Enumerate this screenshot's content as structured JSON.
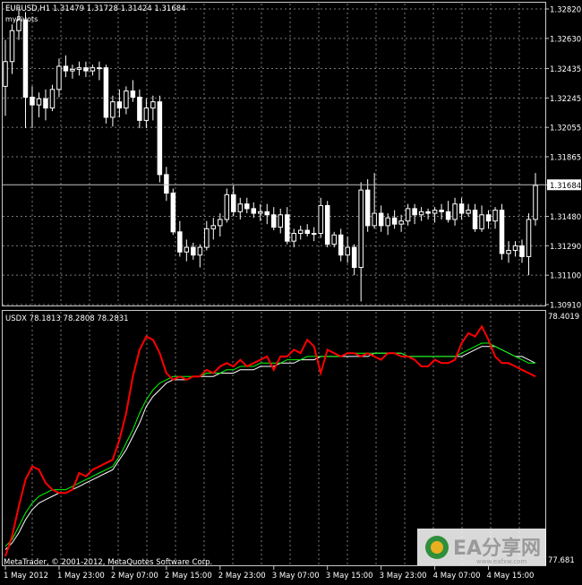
{
  "colors": {
    "background": "#000000",
    "grid": "#7a7a7a",
    "frame": "#c8c8c8",
    "candle": "#ffffff",
    "usdx_line": "#ff0000",
    "ma_fast": "#00ff00",
    "ma_slow": "#ffffff",
    "current_price_line": "#c0c0c0"
  },
  "header": {
    "symbol_line": "EURUSD,H1  1.31479 1.31728 1.31424 1.31684",
    "indicator_label": "myPivots"
  },
  "sub_header": {
    "label": "USDX 78.1813 78.2808 78.2831"
  },
  "footer": {
    "copyright": "MetaTrader, © 2001-2012, MetaQuotes Software Corp.",
    "watermark": "EA分享网",
    "watermark_url": "www.eafxw.com"
  },
  "chart_data": [
    {
      "type": "candlestick",
      "symbol": "EURUSD",
      "timeframe": "H1",
      "ylim": [
        1.3091,
        1.3282
      ],
      "y_ticks": [
        "1.32820",
        "1.32630",
        "1.32435",
        "1.32245",
        "1.32055",
        "1.31865",
        "1.31684",
        "1.31480",
        "1.31290",
        "1.31100",
        "1.30910"
      ],
      "y_tick_values": [
        1.3282,
        1.3263,
        1.32435,
        1.32245,
        1.32055,
        1.31865,
        1.31684,
        1.3148,
        1.3129,
        1.311,
        1.3091
      ],
      "current_price": 1.31684,
      "x_ticks": [
        "1 May 2012",
        "1 May 23:00",
        "2 May 07:00",
        "2 May 15:00",
        "2 May 23:00",
        "3 May 07:00",
        "3 May 15:00",
        "3 May 23:00",
        "4 May 07:00",
        "4 May 15:00"
      ],
      "x_tick_index": [
        0,
        8,
        16,
        24,
        32,
        40,
        48,
        56,
        64,
        72
      ],
      "candles": [
        [
          1.3232,
          1.3262,
          1.3213,
          1.3248
        ],
        [
          1.3248,
          1.3272,
          1.324,
          1.3268
        ],
        [
          1.3268,
          1.3282,
          1.3262,
          1.3275
        ],
        [
          1.3275,
          1.328,
          1.3205,
          1.3225
        ],
        [
          1.3225,
          1.3232,
          1.3205,
          1.322
        ],
        [
          1.322,
          1.3228,
          1.3212,
          1.3224
        ],
        [
          1.3224,
          1.323,
          1.321,
          1.3218
        ],
        [
          1.3218,
          1.3233,
          1.3216,
          1.323
        ],
        [
          1.323,
          1.325,
          1.3225,
          1.3245
        ],
        [
          1.3245,
          1.3252,
          1.3238,
          1.3242
        ],
        [
          1.3242,
          1.3246,
          1.3237,
          1.3243
        ],
        [
          1.3243,
          1.3248,
          1.3239,
          1.3244
        ],
        [
          1.3244,
          1.3248,
          1.3238,
          1.3242
        ],
        [
          1.3242,
          1.3246,
          1.3239,
          1.3244
        ],
        [
          1.3244,
          1.3248,
          1.3236,
          1.3244
        ],
        [
          1.3244,
          1.3246,
          1.3208,
          1.3212
        ],
        [
          1.3212,
          1.3226,
          1.3206,
          1.3222
        ],
        [
          1.3222,
          1.323,
          1.3212,
          1.3218
        ],
        [
          1.3218,
          1.3232,
          1.3214,
          1.3229
        ],
        [
          1.3229,
          1.3236,
          1.3222,
          1.3225
        ],
        [
          1.3225,
          1.323,
          1.3205,
          1.321
        ],
        [
          1.321,
          1.3224,
          1.3205,
          1.3218
        ],
        [
          1.3218,
          1.3226,
          1.321,
          1.3222
        ],
        [
          1.3222,
          1.3226,
          1.317,
          1.3175
        ],
        [
          1.3175,
          1.318,
          1.3158,
          1.3163
        ],
        [
          1.3163,
          1.3166,
          1.3136,
          1.3138
        ],
        [
          1.3138,
          1.3145,
          1.3122,
          1.3125
        ],
        [
          1.3125,
          1.3133,
          1.3119,
          1.3128
        ],
        [
          1.3128,
          1.3131,
          1.312,
          1.3123
        ],
        [
          1.3123,
          1.313,
          1.3115,
          1.3128
        ],
        [
          1.3128,
          1.3145,
          1.3126,
          1.314
        ],
        [
          1.314,
          1.3147,
          1.3133,
          1.3142
        ],
        [
          1.3142,
          1.315,
          1.3135,
          1.3146
        ],
        [
          1.3146,
          1.3166,
          1.3144,
          1.3162
        ],
        [
          1.3162,
          1.3168,
          1.3148,
          1.3151
        ],
        [
          1.3151,
          1.316,
          1.3146,
          1.3156
        ],
        [
          1.3156,
          1.316,
          1.315,
          1.3153
        ],
        [
          1.3153,
          1.3157,
          1.3147,
          1.315
        ],
        [
          1.315,
          1.3156,
          1.3145,
          1.3151
        ],
        [
          1.3151,
          1.3156,
          1.3143,
          1.3149
        ],
        [
          1.3149,
          1.3154,
          1.3139,
          1.3141
        ],
        [
          1.3141,
          1.3153,
          1.3137,
          1.3149
        ],
        [
          1.3149,
          1.3154,
          1.313,
          1.3132
        ],
        [
          1.3132,
          1.314,
          1.3128,
          1.3137
        ],
        [
          1.3137,
          1.3142,
          1.3133,
          1.3139
        ],
        [
          1.3139,
          1.3143,
          1.3135,
          1.3137
        ],
        [
          1.3137,
          1.3141,
          1.3132,
          1.3137
        ],
        [
          1.3137,
          1.316,
          1.3134,
          1.3155
        ],
        [
          1.3155,
          1.3158,
          1.3128,
          1.313
        ],
        [
          1.313,
          1.3138,
          1.3128,
          1.3136
        ],
        [
          1.3136,
          1.314,
          1.3119,
          1.3123
        ],
        [
          1.3123,
          1.3135,
          1.3118,
          1.3128
        ],
        [
          1.3128,
          1.313,
          1.311,
          1.3115
        ],
        [
          1.3115,
          1.317,
          1.3093,
          1.3165
        ],
        [
          1.3165,
          1.3172,
          1.3138,
          1.3142
        ],
        [
          1.3142,
          1.3176,
          1.314,
          1.315
        ],
        [
          1.315,
          1.3155,
          1.3138,
          1.3142
        ],
        [
          1.3142,
          1.315,
          1.3136,
          1.3147
        ],
        [
          1.3147,
          1.3152,
          1.314,
          1.3143
        ],
        [
          1.3143,
          1.3149,
          1.3138,
          1.3145
        ],
        [
          1.3145,
          1.3156,
          1.3142,
          1.3153
        ],
        [
          1.3153,
          1.3156,
          1.3143,
          1.3149
        ],
        [
          1.3149,
          1.3154,
          1.3145,
          1.3151
        ],
        [
          1.3151,
          1.3153,
          1.3146,
          1.315
        ],
        [
          1.315,
          1.3154,
          1.3144,
          1.3152
        ],
        [
          1.3152,
          1.3156,
          1.3146,
          1.3151
        ],
        [
          1.3151,
          1.3158,
          1.3144,
          1.3146
        ],
        [
          1.3146,
          1.316,
          1.3142,
          1.3156
        ],
        [
          1.3156,
          1.316,
          1.3146,
          1.315
        ],
        [
          1.315,
          1.3156,
          1.3148,
          1.3152
        ],
        [
          1.3152,
          1.3156,
          1.3138,
          1.314
        ],
        [
          1.314,
          1.3155,
          1.3138,
          1.3149
        ],
        [
          1.3149,
          1.3152,
          1.314,
          1.3145
        ],
        [
          1.3145,
          1.3154,
          1.314,
          1.3152
        ],
        [
          1.3152,
          1.3156,
          1.312,
          1.3124
        ],
        [
          1.3124,
          1.3132,
          1.3118,
          1.3126
        ],
        [
          1.3126,
          1.3132,
          1.3122,
          1.3129
        ],
        [
          1.3129,
          1.3133,
          1.3118,
          1.3122
        ],
        [
          1.3122,
          1.315,
          1.311,
          1.3146
        ],
        [
          1.3146,
          1.3176,
          1.3142,
          1.3168
        ]
      ]
    },
    {
      "type": "line",
      "title": "USDX 78.1813 78.2808 78.2831",
      "ylim": [
        77.681,
        78.4019
      ],
      "y_ticks": [
        "78.4019",
        "77.681"
      ],
      "series": [
        {
          "color": "#ff0000",
          "values": [
            77.7,
            77.76,
            77.85,
            77.93,
            77.97,
            77.96,
            77.92,
            77.9,
            77.89,
            77.89,
            77.9,
            77.95,
            77.94,
            77.96,
            77.97,
            77.98,
            77.99,
            78.05,
            78.13,
            78.24,
            78.32,
            78.36,
            78.35,
            78.31,
            78.25,
            78.23,
            78.24,
            78.23,
            78.24,
            78.24,
            78.26,
            78.25,
            78.27,
            78.28,
            78.27,
            78.29,
            78.27,
            78.28,
            78.29,
            78.3,
            78.26,
            78.3,
            78.3,
            78.32,
            78.31,
            78.35,
            78.33,
            78.25,
            78.32,
            78.31,
            78.3,
            78.31,
            78.31,
            78.3,
            78.31,
            78.3,
            78.29,
            78.31,
            78.31,
            78.3,
            78.3,
            78.29,
            78.27,
            78.27,
            78.29,
            78.28,
            78.28,
            78.29,
            78.34,
            78.37,
            78.36,
            78.39,
            78.35,
            78.3,
            78.28,
            78.28,
            78.27,
            78.26,
            78.25,
            78.24
          ]
        },
        {
          "color": "#00ff00",
          "values": [
            77.73,
            77.75,
            77.79,
            77.83,
            77.86,
            77.88,
            77.89,
            77.9,
            77.9,
            77.9,
            77.91,
            77.92,
            77.93,
            77.94,
            77.95,
            77.96,
            77.97,
            78.0,
            78.04,
            78.08,
            78.13,
            78.17,
            78.2,
            78.22,
            78.23,
            78.24,
            78.24,
            78.24,
            78.24,
            78.24,
            78.25,
            78.25,
            78.25,
            78.26,
            78.26,
            78.27,
            78.27,
            78.27,
            78.28,
            78.28,
            78.28,
            78.28,
            78.29,
            78.29,
            78.29,
            78.3,
            78.3,
            78.3,
            78.3,
            78.3,
            78.3,
            78.31,
            78.31,
            78.31,
            78.31,
            78.31,
            78.31,
            78.31,
            78.31,
            78.31,
            78.3,
            78.3,
            78.3,
            78.3,
            78.3,
            78.3,
            78.3,
            78.3,
            78.31,
            78.32,
            78.33,
            78.34,
            78.34,
            78.33,
            78.32,
            78.31,
            78.3,
            78.29,
            78.28,
            78.28
          ]
        },
        {
          "color": "#ffffff",
          "values": [
            77.72,
            77.74,
            77.77,
            77.81,
            77.84,
            77.86,
            77.87,
            77.88,
            77.89,
            77.89,
            77.9,
            77.91,
            77.92,
            77.93,
            77.94,
            77.95,
            77.96,
            77.99,
            78.02,
            78.06,
            78.1,
            78.15,
            78.18,
            78.2,
            78.22,
            78.23,
            78.23,
            78.23,
            78.24,
            78.24,
            78.24,
            78.24,
            78.25,
            78.25,
            78.25,
            78.26,
            78.26,
            78.26,
            78.27,
            78.27,
            78.27,
            78.28,
            78.28,
            78.28,
            78.29,
            78.29,
            78.29,
            78.3,
            78.3,
            78.3,
            78.3,
            78.3,
            78.3,
            78.3,
            78.3,
            78.31,
            78.31,
            78.31,
            78.31,
            78.31,
            78.3,
            78.3,
            78.3,
            78.3,
            78.3,
            78.3,
            78.3,
            78.3,
            78.3,
            78.31,
            78.32,
            78.33,
            78.33,
            78.33,
            78.32,
            78.31,
            78.3,
            78.3,
            78.29,
            78.28
          ]
        }
      ]
    }
  ]
}
